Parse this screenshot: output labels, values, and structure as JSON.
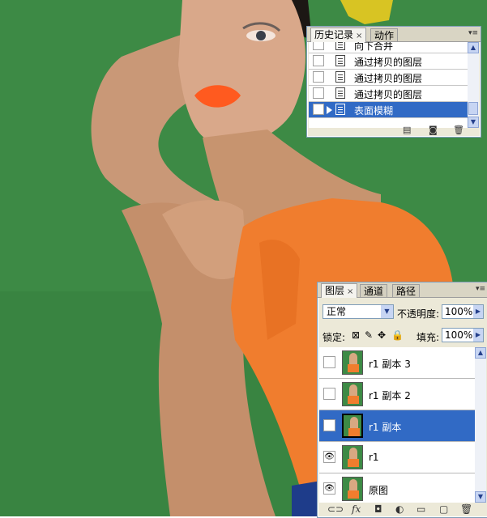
{
  "history_panel": {
    "tabs": [
      {
        "label": "历史记录",
        "active": true
      },
      {
        "label": "动作",
        "active": false
      }
    ],
    "items": [
      {
        "label": "向下合并",
        "selected": false
      },
      {
        "label": "通过拷贝的图层",
        "selected": false
      },
      {
        "label": "通过拷贝的图层",
        "selected": false
      },
      {
        "label": "通过拷贝的图层",
        "selected": false
      },
      {
        "label": "表面模糊",
        "selected": true
      }
    ],
    "footer_icons": [
      "new-document-icon",
      "camera-icon",
      "trash-icon"
    ]
  },
  "layers_panel": {
    "tabs": [
      {
        "label": "图层",
        "active": true
      },
      {
        "label": "通道",
        "active": false
      },
      {
        "label": "路径",
        "active": false
      }
    ],
    "blend_mode": "正常",
    "opacity_label": "不透明度:",
    "opacity_value": "100%",
    "lock_label": "锁定:",
    "fill_label": "填充:",
    "fill_value": "100%",
    "layers": [
      {
        "name": "r1 副本 3",
        "visible": false,
        "selected": false
      },
      {
        "name": "r1 副本 2",
        "visible": false,
        "selected": false
      },
      {
        "name": "r1 副本",
        "visible": true,
        "selected": true
      },
      {
        "name": "r1",
        "visible": true,
        "selected": false
      },
      {
        "name": "原图",
        "visible": true,
        "selected": false
      }
    ],
    "footer_icons": [
      "link-icon",
      "fx-icon",
      "mask-icon",
      "adjustment-icon",
      "folder-icon",
      "new-layer-icon",
      "trash-icon"
    ]
  },
  "colors": {
    "background_green": "#3d8a45",
    "selection_blue": "#316ac5",
    "panel_bg": "#ece9d8"
  }
}
